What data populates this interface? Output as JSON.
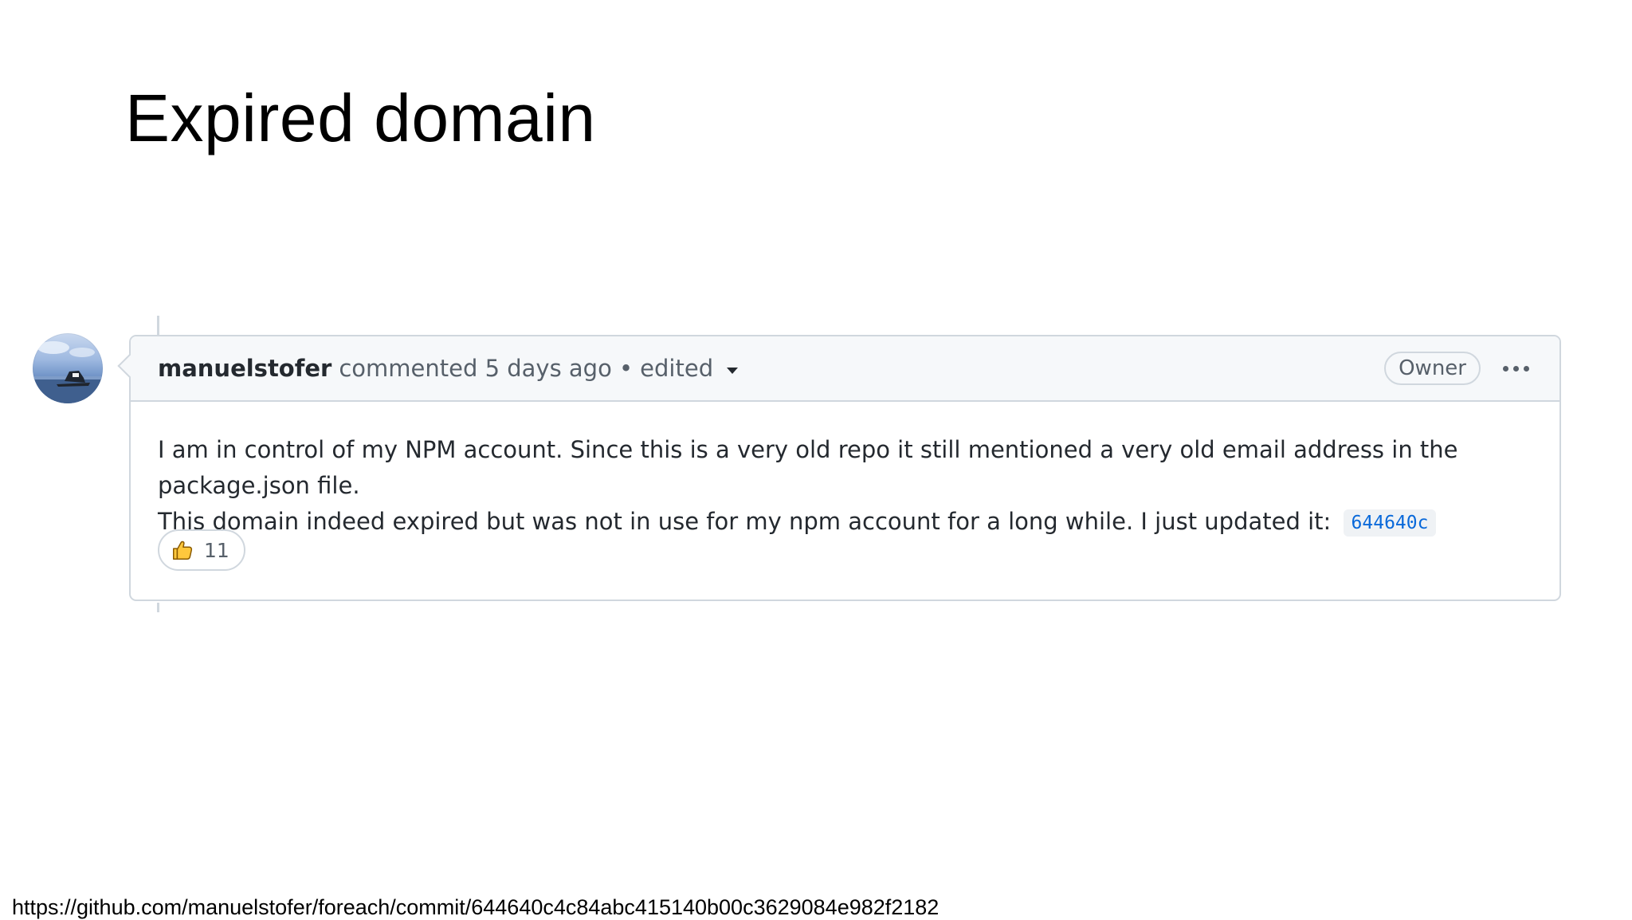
{
  "slide": {
    "title": "Expired domain",
    "source_url": "https://github.com/manuelstofer/foreach/commit/644640c4c84abc415140b00c3629084e982f2182"
  },
  "comment": {
    "author": "manuelstofer",
    "meta": "commented 5 days ago •",
    "edited_label": "edited",
    "badge": "Owner",
    "body_line1": "I am in control of my NPM account. Since this is a very old repo it still mentioned a very old email address in the package.json file.",
    "body_line2": "This domain indeed expired but was not in use for my npm account for a long while. I just updated it:",
    "commit_sha": "644640c",
    "reaction": {
      "icon": "thumbs-up-icon",
      "count": "11"
    }
  },
  "colors": {
    "border": "#d0d7de",
    "header_bg": "#f6f8fa",
    "link": "#0969da",
    "muted_text": "#57606a",
    "text": "#24292f"
  }
}
